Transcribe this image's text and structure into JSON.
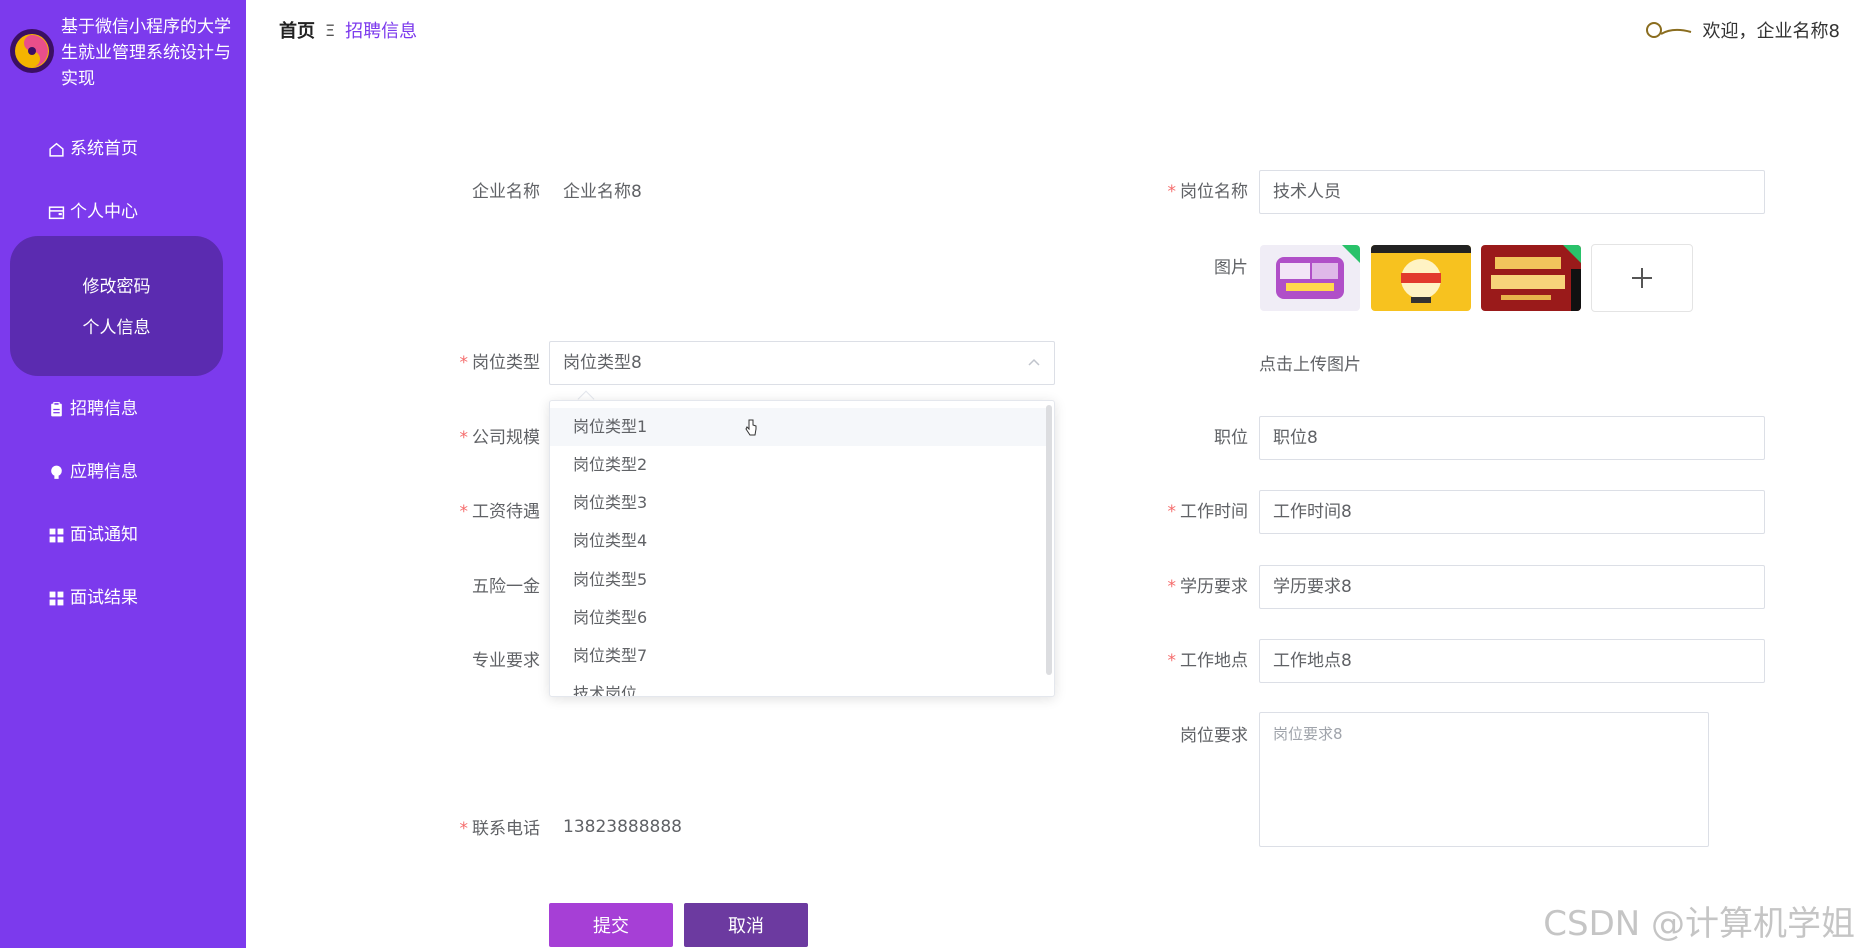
{
  "brand": {
    "title": "基于微信小程序的大学生就业管理系统设计与实现"
  },
  "sidebar": {
    "items": [
      {
        "label": "系统首页",
        "icon": "home-icon"
      },
      {
        "label": "个人中心",
        "icon": "wallet-icon"
      },
      {
        "label": "招聘信息",
        "icon": "clipboard-icon"
      },
      {
        "label": "应聘信息",
        "icon": "bulb-icon"
      },
      {
        "label": "面试通知",
        "icon": "grid-icon"
      },
      {
        "label": "面试结果",
        "icon": "grid-icon"
      }
    ],
    "submenu": [
      {
        "label": "修改密码"
      },
      {
        "label": "个人信息"
      }
    ]
  },
  "breadcrumb": {
    "home": "首页",
    "separator": "Ξ",
    "current": "招聘信息"
  },
  "user": {
    "welcome": "欢迎，企业名称8"
  },
  "form": {
    "company_name": {
      "label": "企业名称",
      "value": "企业名称8"
    },
    "job_type": {
      "label": "岗位类型",
      "value": "岗位类型8",
      "options": [
        "岗位类型1",
        "岗位类型2",
        "岗位类型3",
        "岗位类型4",
        "岗位类型5",
        "岗位类型6",
        "岗位类型7",
        "技术岗位"
      ]
    },
    "company_size": {
      "label": "公司规模"
    },
    "salary": {
      "label": "工资待遇"
    },
    "insurance": {
      "label": "五险一金"
    },
    "major": {
      "label": "专业要求"
    },
    "phone": {
      "label": "联系电话",
      "value": "13823888888"
    },
    "job_name": {
      "label": "岗位名称",
      "value": "技术人员"
    },
    "images": {
      "label": "图片",
      "hint": "点击上传图片"
    },
    "position": {
      "label": "职位",
      "value": "职位8"
    },
    "work_time": {
      "label": "工作时间",
      "value": "工作时间8"
    },
    "education": {
      "label": "学历要求",
      "value": "学历要求8"
    },
    "location": {
      "label": "工作地点",
      "value": "工作地点8"
    },
    "requirements": {
      "label": "岗位要求",
      "value": "岗位要求8"
    },
    "submit_label": "提交",
    "cancel_label": "取消"
  },
  "watermark": "CSDN @计算机学姐",
  "colors": {
    "sidebar": "#7c3aed",
    "submenu": "#5b2bb0",
    "accent": "#7c3aed",
    "required": "#f56c6c",
    "submit": "#a63fd6",
    "cancel": "#6c3aa0"
  }
}
